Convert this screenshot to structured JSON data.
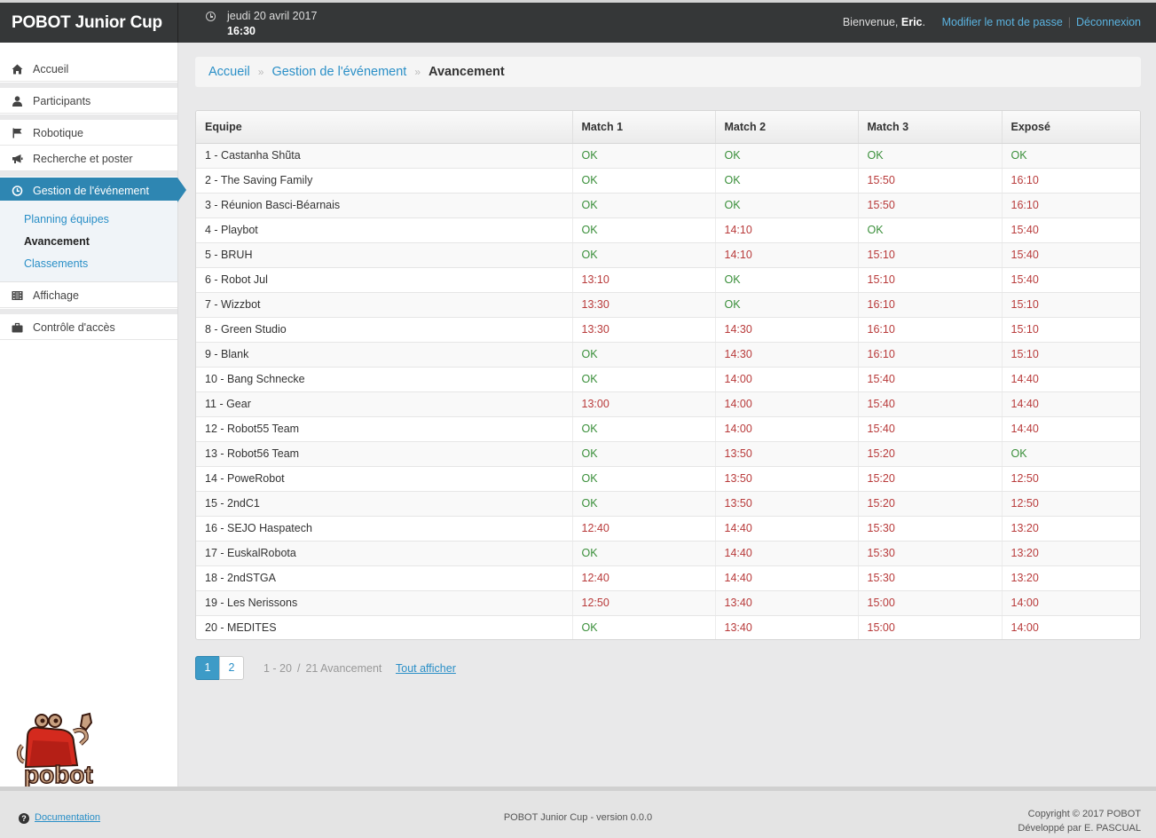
{
  "header": {
    "brand": "POBOT Junior Cup",
    "date": "jeudi 20 avril 2017",
    "time": "16:30",
    "welcome_prefix": "Bienvenue, ",
    "user": "Eric",
    "welcome_suffix": ".",
    "change_password": "Modifier le mot de passe",
    "separator": "|",
    "logout": "Déconnexion"
  },
  "sidebar": {
    "items": [
      {
        "label": "Accueil",
        "icon": "home-icon"
      },
      {
        "label": "Participants",
        "icon": "user-icon"
      },
      {
        "label": "Robotique",
        "icon": "flag-icon"
      },
      {
        "label": "Recherche et poster",
        "icon": "megaphone-icon"
      },
      {
        "label": "Gestion de l'événement",
        "icon": "clock-icon"
      },
      {
        "label": "Affichage",
        "icon": "film-icon"
      },
      {
        "label": "Contrôle d'accès",
        "icon": "briefcase-icon"
      }
    ],
    "subitems": [
      {
        "label": "Planning équipes"
      },
      {
        "label": "Avancement"
      },
      {
        "label": "Classements"
      }
    ]
  },
  "breadcrumb": {
    "home": "Accueil",
    "section": "Gestion de l'événement",
    "current": "Avancement",
    "arrow": "»"
  },
  "table": {
    "headers": [
      "Equipe",
      "Match 1",
      "Match 2",
      "Match 3",
      "Exposé"
    ],
    "rows": [
      [
        "1 - Castanha Shũta",
        "OK",
        "OK",
        "OK",
        "OK"
      ],
      [
        "2 - The Saving Family",
        "OK",
        "OK",
        "15:50",
        "16:10"
      ],
      [
        "3 - Réunion Basci-Béarnais",
        "OK",
        "OK",
        "15:50",
        "16:10"
      ],
      [
        "4 - Playbot",
        "OK",
        "14:10",
        "OK",
        "15:40"
      ],
      [
        "5 - BRUH",
        "OK",
        "14:10",
        "15:10",
        "15:40"
      ],
      [
        "6 - Robot Jul",
        "13:10",
        "OK",
        "15:10",
        "15:40"
      ],
      [
        "7 - Wizzbot",
        "13:30",
        "OK",
        "16:10",
        "15:10"
      ],
      [
        "8 - Green Studio",
        "13:30",
        "14:30",
        "16:10",
        "15:10"
      ],
      [
        "9 - Blank",
        "OK",
        "14:30",
        "16:10",
        "15:10"
      ],
      [
        "10 - Bang Schnecke",
        "OK",
        "14:00",
        "15:40",
        "14:40"
      ],
      [
        "11 - Gear",
        "13:00",
        "14:00",
        "15:40",
        "14:40"
      ],
      [
        "12 - Robot55 Team",
        "OK",
        "14:00",
        "15:40",
        "14:40"
      ],
      [
        "13 - Robot56 Team",
        "OK",
        "13:50",
        "15:20",
        "OK"
      ],
      [
        "14 - PoweRobot",
        "OK",
        "13:50",
        "15:20",
        "12:50"
      ],
      [
        "15 - 2ndC1",
        "OK",
        "13:50",
        "15:20",
        "12:50"
      ],
      [
        "16 - SEJO Haspatech",
        "12:40",
        "14:40",
        "15:30",
        "13:20"
      ],
      [
        "17 - EuskalRobota",
        "OK",
        "14:40",
        "15:30",
        "13:20"
      ],
      [
        "18 - 2ndSTGA",
        "12:40",
        "14:40",
        "15:30",
        "13:20"
      ],
      [
        "19 - Les Nerissons",
        "12:50",
        "13:40",
        "15:00",
        "14:00"
      ],
      [
        "20 - MEDITES",
        "OK",
        "13:40",
        "15:00",
        "14:00"
      ]
    ]
  },
  "pagination": {
    "pages": [
      "1",
      "2"
    ],
    "current": "1",
    "range": "1 - 20",
    "slash": "/",
    "total": "21 Avancement",
    "show_all": "Tout afficher"
  },
  "footer": {
    "doc_label": "Documentation",
    "version": "POBOT Junior Cup - version 0.0.0",
    "copyright": "Copyright © 2017 POBOT",
    "developer": "Développé par E. PASCUAL"
  },
  "colors": {
    "ok": "#3a8f3a",
    "late": "#b83a3a",
    "accent": "#2e86b2",
    "topbar": "#353738"
  },
  "logo": {
    "text": "pobot",
    "icon": "robot-logo"
  }
}
